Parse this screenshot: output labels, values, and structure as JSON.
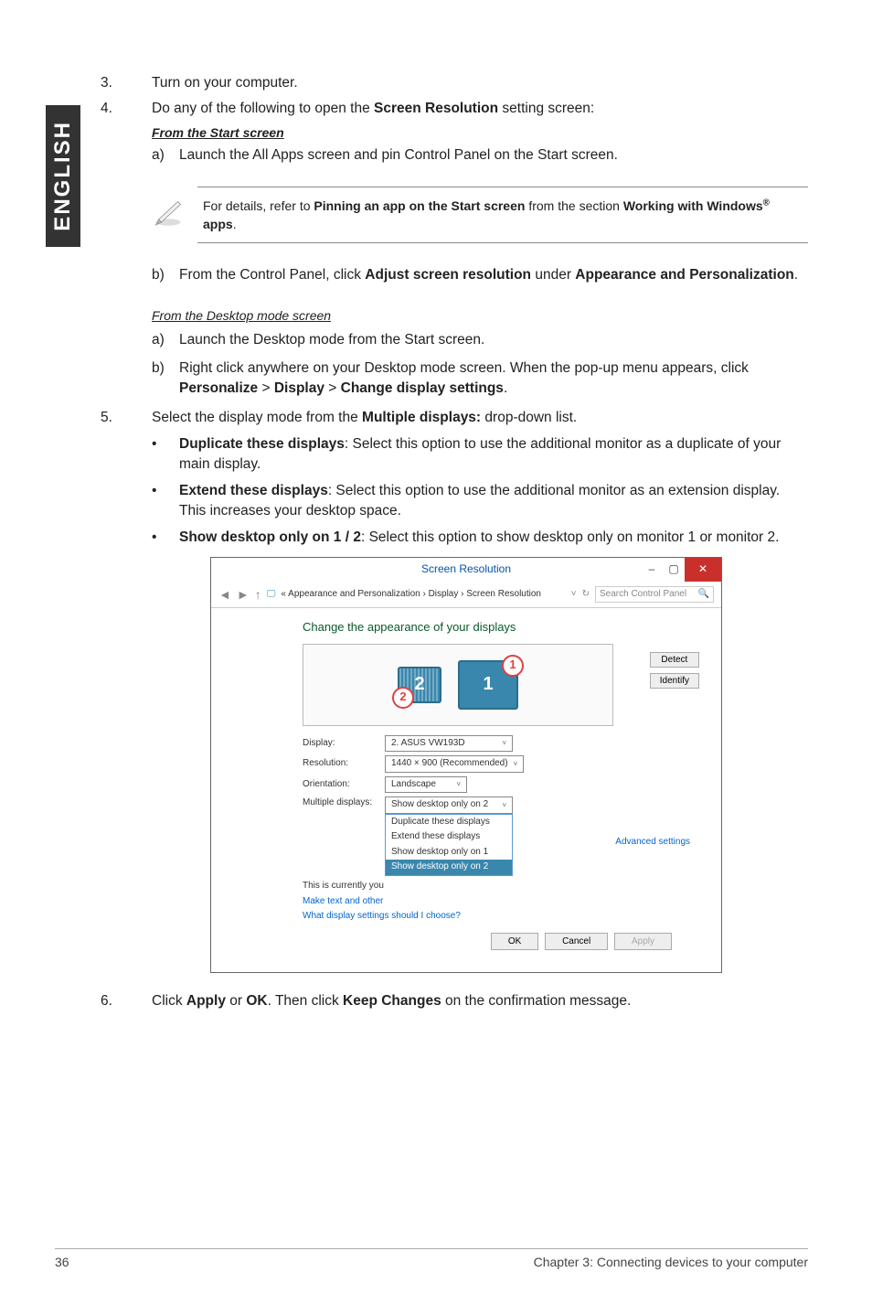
{
  "side_tab": "ENGLISH",
  "steps": {
    "s3": {
      "num": "3.",
      "text": "Turn on your computer."
    },
    "s4": {
      "num": "4.",
      "intro_a": "Do any of the following to open the ",
      "intro_bold": "Screen Resolution",
      "intro_b": " setting screen:",
      "from_start": "From the Start screen",
      "a": {
        "let": "a)",
        "text": "Launch the All Apps screen and pin Control Panel on the Start screen."
      },
      "note_a": "For details, refer to ",
      "note_bold1": "Pinning an app on the Start screen",
      "note_b": " from the section ",
      "note_bold2": "Working with Windows",
      "note_sup": "®",
      "note_bold3": " apps",
      "note_c": ".",
      "b": {
        "let": "b)",
        "t1": "From the Control Panel, click ",
        "b1": "Adjust screen resolution",
        "t2": " under ",
        "b2": "Appearance and Personalization",
        "t3": "."
      },
      "from_desktop": "From the Desktop mode screen",
      "da": {
        "let": "a)",
        "text": "Launch the Desktop mode from the Start screen."
      },
      "db": {
        "let": "b)",
        "t1": "Right click anywhere on your Desktop mode screen. When the pop-up menu appears, click ",
        "b1": "Personalize",
        "gt1": " > ",
        "b2": "Display",
        "gt2": " > ",
        "b3": "Change display settings",
        "t2": "."
      }
    },
    "s5": {
      "num": "5.",
      "t1": "Select the display mode from the ",
      "b1": "Multiple displays:",
      "t2": " drop-down list.",
      "bul1": {
        "b": "Duplicate these displays",
        "t": ": Select this option to use the additional monitor as a duplicate of your main display."
      },
      "bul2": {
        "b": "Extend these displays",
        "t": ": Select this option to use the additional monitor as an extension display. This increases your desktop space."
      },
      "bul3": {
        "b": "Show desktop only on 1 / 2",
        "t": ": Select this option to show desktop only on monitor 1 or monitor 2."
      }
    },
    "s6": {
      "num": "6.",
      "t1": "Click ",
      "b1": "Apply",
      "t2": " or ",
      "b2": "OK",
      "t3": ". Then click ",
      "b3": "Keep Changes",
      "t4": " on the confirmation message."
    }
  },
  "screenshot": {
    "title": "Screen Resolution",
    "crumb": "« Appearance and Personalization › Display › Screen Resolution",
    "search_placeholder": "Search Control Panel",
    "heading": "Change the appearance of your displays",
    "detect": "Detect",
    "identify": "Identify",
    "mon1": "1",
    "mon2": "2",
    "circle1": "1",
    "circle2": "2",
    "display_label": "Display:",
    "display_value": "2. ASUS VW193D",
    "resolution_label": "Resolution:",
    "resolution_value": "1440 × 900 (Recommended)",
    "orientation_label": "Orientation:",
    "orientation_value": "Landscape",
    "multi_label": "Multiple displays:",
    "multi_value": "Show desktop only on 2",
    "opt1": "Duplicate these displays",
    "opt2": "Extend these displays",
    "opt3": "Show desktop only on 1",
    "opt4": "Show desktop only on 2",
    "currently_a": "This is currently you",
    "advanced": "Advanced settings",
    "make_text": "Make text and other",
    "what_settings": "What display settings should I choose?",
    "ok": "OK",
    "cancel": "Cancel",
    "apply": "Apply"
  },
  "footer": {
    "page": "36",
    "chapter": "Chapter 3: Connecting devices to your computer"
  }
}
